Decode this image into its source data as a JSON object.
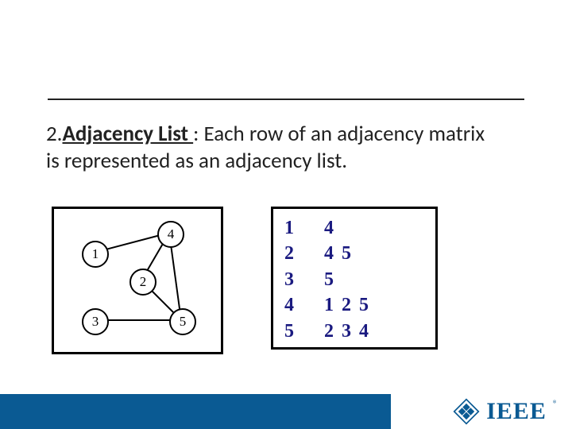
{
  "heading": {
    "number": "2.",
    "term": "Adjacency List ",
    "rest": ": Each row of an adjacency matrix is represented as an adjacency list."
  },
  "graph": {
    "nodes": [
      "1",
      "2",
      "3",
      "4",
      "5"
    ]
  },
  "adjacency": [
    {
      "idx": "1",
      "vals": "4"
    },
    {
      "idx": "2",
      "vals": "4 5"
    },
    {
      "idx": "3",
      "vals": "5"
    },
    {
      "idx": "4",
      "vals": "1 2 5"
    },
    {
      "idx": "5",
      "vals": "2 3 4"
    }
  ],
  "logo": {
    "text": "IEEE",
    "reg": "®"
  }
}
